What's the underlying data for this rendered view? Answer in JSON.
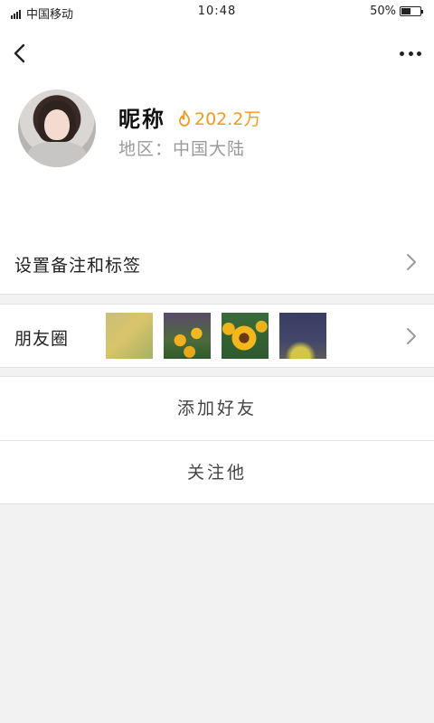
{
  "status_bar": {
    "carrier": "中国移动",
    "time": "10:48",
    "battery": "50%",
    "battery_level": 0.5,
    "signal_icon": "signal-icon",
    "battery_icon": "battery-icon"
  },
  "header": {
    "back_icon": "chevron-left-icon",
    "more_icon": "more-dots-icon"
  },
  "profile": {
    "nickname": "昵称",
    "hot_icon": "flame-icon",
    "hot_count": "202.2万",
    "region": "地区：中国大陆",
    "accent_color": "#f39a1f"
  },
  "rows": {
    "tags_label": "设置备注和标签",
    "moments_label": "朋友圈",
    "moments_thumb_count": 4,
    "chevron_icon": "chevron-right-icon"
  },
  "actions": {
    "add_friend": "添加好友",
    "follow": "关注他"
  }
}
